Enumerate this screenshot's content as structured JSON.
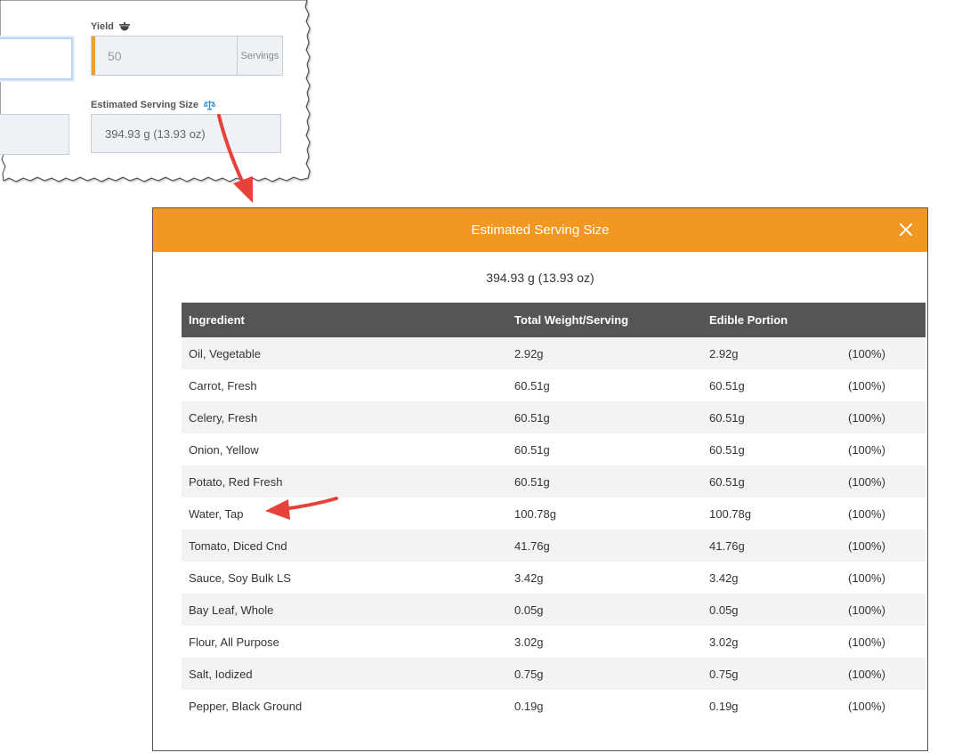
{
  "form": {
    "yield_label": "Yield",
    "yield_value": "50",
    "yield_unit": "Servings",
    "serving_size_label": "Estimated Serving Size",
    "serving_size_value": "394.93 g (13.93 oz)"
  },
  "modal": {
    "title": "Estimated Serving Size",
    "summary": "394.93 g (13.93 oz)",
    "columns": [
      "Ingredient",
      "Total Weight/Serving",
      "Edible Portion",
      ""
    ],
    "rows": [
      [
        "Oil, Vegetable",
        "2.92g",
        "2.92g",
        "(100%)"
      ],
      [
        "Carrot, Fresh",
        "60.51g",
        "60.51g",
        "(100%)"
      ],
      [
        "Celery, Fresh",
        "60.51g",
        "60.51g",
        "(100%)"
      ],
      [
        "Onion, Yellow",
        "60.51g",
        "60.51g",
        "(100%)"
      ],
      [
        "Potato, Red Fresh",
        "60.51g",
        "60.51g",
        "(100%)"
      ],
      [
        "Water, Tap",
        "100.78g",
        "100.78g",
        "(100%)"
      ],
      [
        "Tomato, Diced Cnd",
        "41.76g",
        "41.76g",
        "(100%)"
      ],
      [
        "Sauce, Soy Bulk LS",
        "3.42g",
        "3.42g",
        "(100%)"
      ],
      [
        "Bay Leaf, Whole",
        "0.05g",
        "0.05g",
        "(100%)"
      ],
      [
        "Flour, All Purpose",
        "3.02g",
        "3.02g",
        "(100%)"
      ],
      [
        "Salt, Iodized",
        "0.75g",
        "0.75g",
        "(100%)"
      ],
      [
        "Pepper, Black Ground",
        "0.19g",
        "0.19g",
        "(100%)"
      ]
    ]
  },
  "colors": {
    "header_orange": "#f29720",
    "table_header": "#555555",
    "arrow_red": "#e8413a",
    "scale_icon_blue": "#3a8fd6"
  },
  "icons": {
    "yield": "serving-bowl-icon",
    "serving_size": "scale-icon",
    "close": "close-icon"
  }
}
